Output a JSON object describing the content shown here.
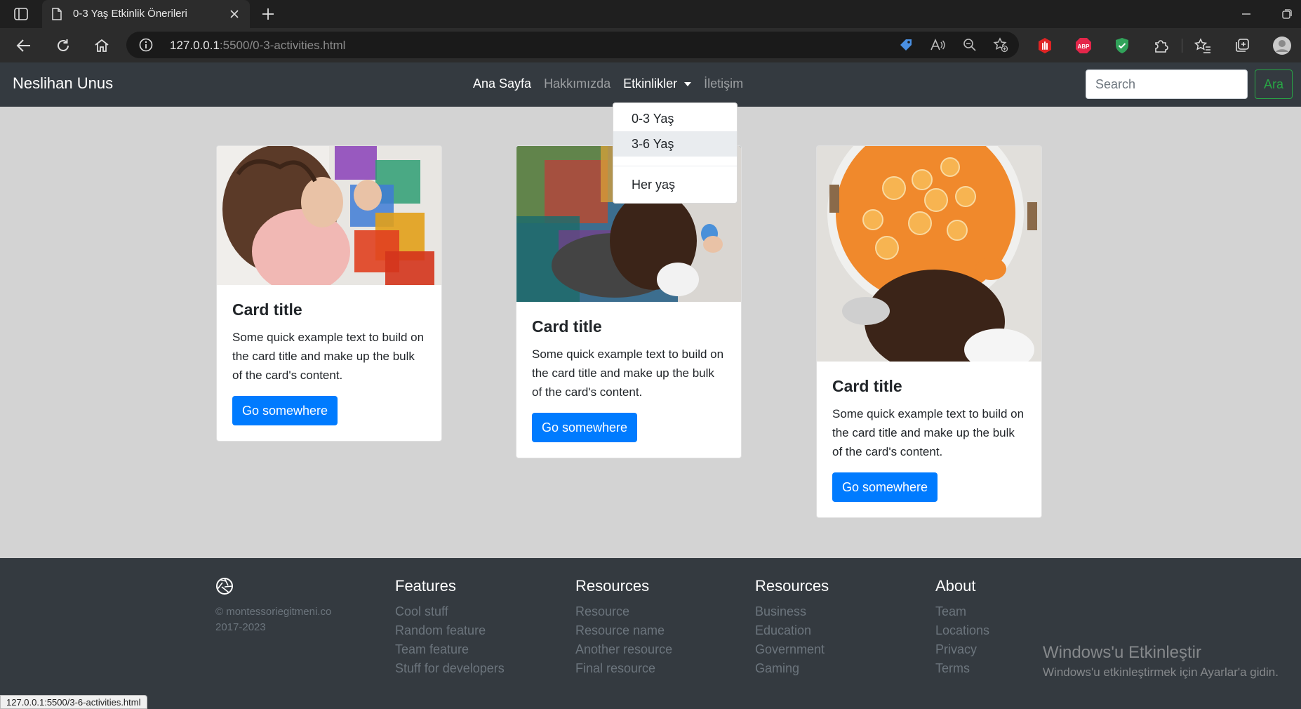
{
  "browser": {
    "tab_title": "0-3 Yaş Etkinlik Önerileri",
    "url_host": "127.0.0.1",
    "url_rest": ":5500/0-3-activities.html",
    "status_url": "127.0.0.1:5500/3-6-activities.html"
  },
  "navbar": {
    "brand": "Neslihan Unus",
    "links": [
      "Ana Sayfa",
      "Hakkımızda",
      "Etkinlikler",
      "İletişim"
    ],
    "search_placeholder": "Search",
    "search_button": "Ara"
  },
  "dropdown": {
    "items": [
      "0-3 Yaş",
      "3-6 Yaş",
      "Her yaş"
    ],
    "hovered_item": "3-6 Yaş"
  },
  "cards": [
    {
      "title": "Card title",
      "text": "Some quick example text to build on the card title and make up the bulk of the card's content.",
      "button": "Go somewhere"
    },
    {
      "title": "Card title",
      "text": "Some quick example text to build on the card title and make up the bulk of the card's content.",
      "button": "Go somewhere"
    },
    {
      "title": "Card title",
      "text": "Some quick example text to build on the card title and make up the bulk of the card's content.",
      "button": "Go somewhere"
    }
  ],
  "footer": {
    "copyright": "© montessoriegitmeni.co",
    "years": "2017-2023",
    "columns": [
      {
        "heading": "Features",
        "links": [
          "Cool stuff",
          "Random feature",
          "Team feature",
          "Stuff for developers"
        ]
      },
      {
        "heading": "Resources",
        "links": [
          "Resource",
          "Resource name",
          "Another resource",
          "Final resource"
        ]
      },
      {
        "heading": "Resources",
        "links": [
          "Business",
          "Education",
          "Government",
          "Gaming"
        ]
      },
      {
        "heading": "About",
        "links": [
          "Team",
          "Locations",
          "Privacy",
          "Terms"
        ]
      }
    ]
  },
  "watermark": {
    "title": "Windows'u Etkinleştir",
    "subtitle": "Windows'u etkinleştirmek için Ayarlar'a gidin."
  },
  "colors": {
    "navbar_bg": "#343a40",
    "page_bg": "#d3d3d3",
    "primary": "#007bff",
    "success": "#28a745"
  }
}
